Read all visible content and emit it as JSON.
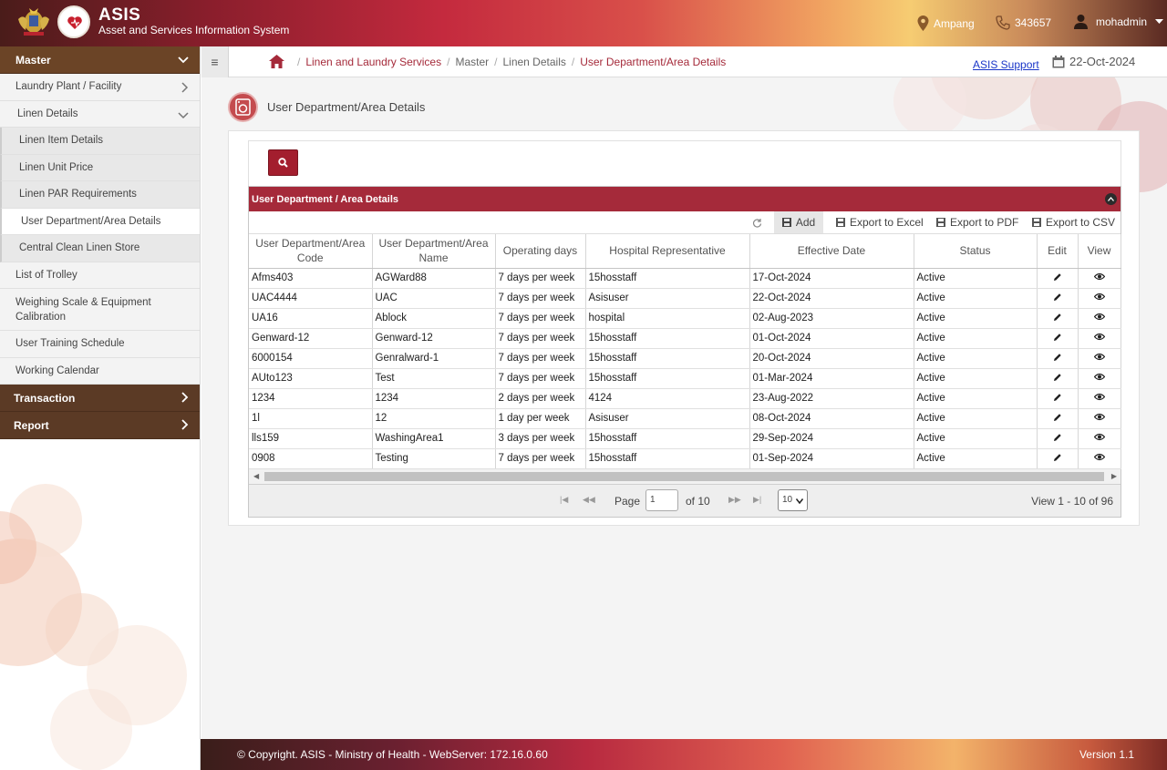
{
  "header": {
    "brand": "ASIS",
    "subtitle": "Asset and Services Information System",
    "location": "Ampang",
    "phone": "343657",
    "user": "mohadmin"
  },
  "sidebar": {
    "master_label": "Master",
    "items": [
      {
        "label": "Laundry Plant / Facility"
      },
      {
        "label": "Linen Details"
      },
      {
        "label": "Linen Item Details"
      },
      {
        "label": "Linen Unit Price"
      },
      {
        "label": "Linen PAR Requirements"
      },
      {
        "label": "User Department/Area Details"
      },
      {
        "label": "Central Clean Linen Store"
      },
      {
        "label": "List of Trolley"
      },
      {
        "label": "Weighing Scale & Equipment Calibration"
      },
      {
        "label": "User Training Schedule"
      },
      {
        "label": "Working Calendar"
      }
    ],
    "transaction_label": "Transaction",
    "report_label": "Report"
  },
  "breadcrumb": {
    "items": [
      "Linen and Laundry Services",
      "Master",
      "Linen Details",
      "User Department/Area Details"
    ]
  },
  "support_link": "ASIS Support",
  "date": "22-Oct-2024",
  "page_title": "User Department/Area Details",
  "grid": {
    "caption": "User Department / Area Details",
    "toolbar": {
      "add": "Add",
      "export_excel": "Export to Excel",
      "export_pdf": "Export to PDF",
      "export_csv": "Export to CSV"
    },
    "columns": [
      "User Department/Area Code",
      "User Department/Area Name",
      "Operating days",
      "Hospital Representative",
      "Effective Date",
      "Status",
      "Edit",
      "View"
    ],
    "rows": [
      [
        "Afms403",
        "AGWard88",
        "7 days per week",
        "15hosstaff",
        "17-Oct-2024",
        "Active"
      ],
      [
        "UAC4444",
        "UAC",
        "7 days per week",
        "Asisuser",
        "22-Oct-2024",
        "Active"
      ],
      [
        "UA16",
        "Ablock",
        "7 days per week",
        "hospital",
        "02-Aug-2023",
        "Active"
      ],
      [
        "Genward-12",
        "Genward-12",
        "7 days per week",
        "15hosstaff",
        "01-Oct-2024",
        "Active"
      ],
      [
        "6000154",
        "Genralward-1",
        "7 days per week",
        "15hosstaff",
        "20-Oct-2024",
        "Active"
      ],
      [
        "AUto123",
        "Test",
        "7 days per week",
        "15hosstaff",
        "01-Mar-2024",
        "Active"
      ],
      [
        "1234",
        "1234",
        "2 days per week",
        "4124",
        "23-Aug-2022",
        "Active"
      ],
      [
        "1l",
        "12",
        "1 day per week",
        "Asisuser",
        "08-Oct-2024",
        "Active"
      ],
      [
        "lls159",
        "WashingArea1",
        "3 days per week",
        "15hosstaff",
        "29-Sep-2024",
        "Active"
      ],
      [
        "0908",
        "Testing",
        "7 days per week",
        "15hosstaff",
        "01-Sep-2024",
        "Active"
      ]
    ],
    "pager": {
      "page_label": "Page",
      "current_page": "1",
      "of_label": "of 10",
      "page_size": "10",
      "view_text": "View 1 - 10 of 96"
    }
  },
  "footer": {
    "copyright": "© Copyright. ASIS - Ministry of Health - WebServer: 172.16.0.60",
    "version": "Version 1.1"
  },
  "colors": {
    "brand_red": "#a52a3a",
    "menu_brown": "#5b3a25",
    "link_blue": "#1a36c8"
  }
}
